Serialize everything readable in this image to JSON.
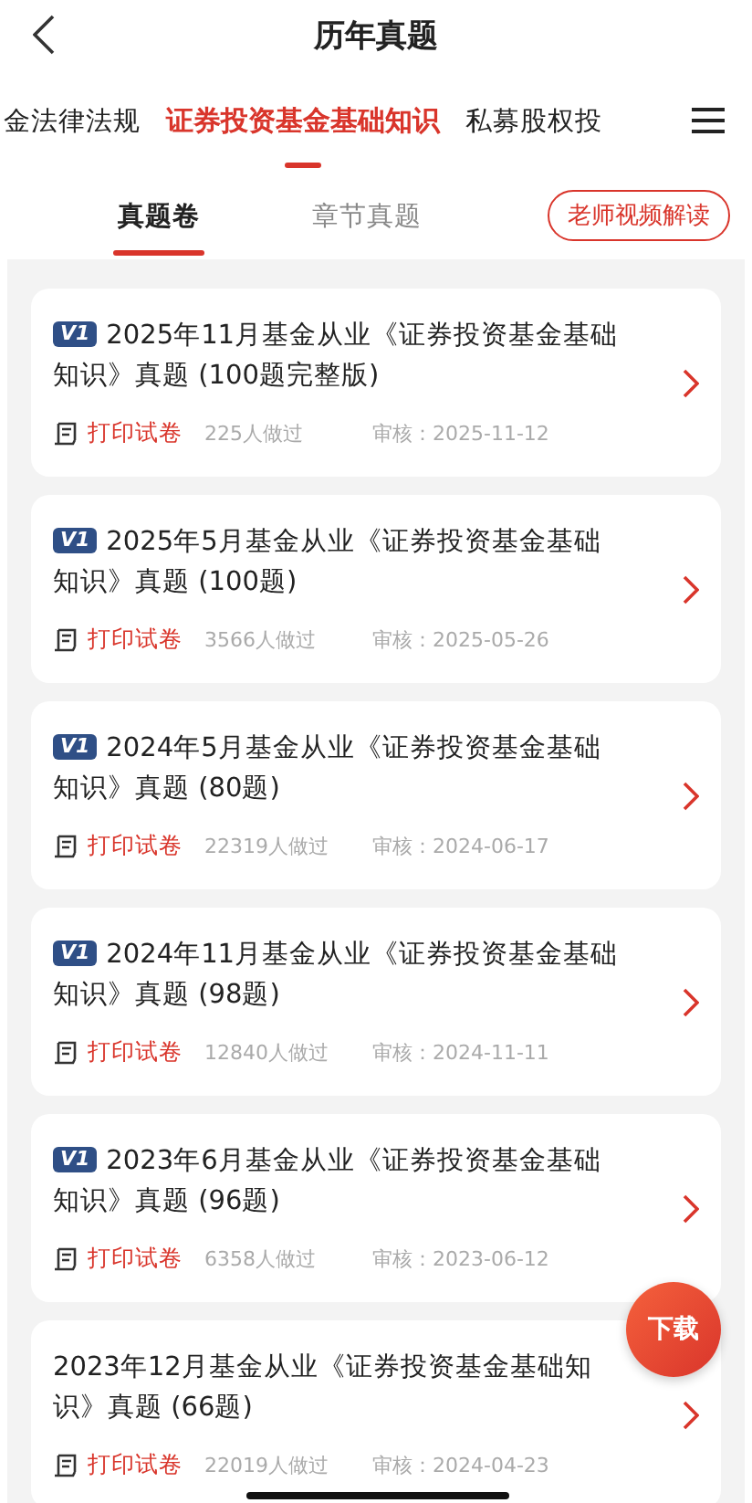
{
  "header": {
    "title": "历年真题"
  },
  "categories": [
    {
      "label": "金法律法规",
      "selected": false
    },
    {
      "label": "证券投资基金基础知识",
      "selected": true
    },
    {
      "label": "私募股权投",
      "selected": false
    }
  ],
  "subtabs": [
    {
      "label": "真题卷",
      "selected": true
    },
    {
      "label": "章节真题",
      "selected": false
    }
  ],
  "video_button": "老师视频解读",
  "papers": [
    {
      "badge": "V1",
      "title": "2025年11月基金从业《证券投资基金基础知识》真题 (100题完整版)",
      "print": "打印试卷",
      "done": "225人做过",
      "review": "审核：2025-11-12"
    },
    {
      "badge": "V1",
      "title": "2025年5月基金从业《证券投资基金基础知识》真题 (100题)",
      "print": "打印试卷",
      "done": "3566人做过",
      "review": "审核：2025-05-26"
    },
    {
      "badge": "V1",
      "title": "2024年5月基金从业《证券投资基金基础知识》真题 (80题)",
      "print": "打印试卷",
      "done": "22319人做过",
      "review": "审核：2024-06-17"
    },
    {
      "badge": "V1",
      "title": "2024年11月基金从业《证券投资基金基础知识》真题 (98题)",
      "print": "打印试卷",
      "done": "12840人做过",
      "review": "审核：2024-11-11"
    },
    {
      "badge": "V1",
      "title": "2023年6月基金从业《证券投资基金基础知识》真题 (96题)",
      "print": "打印试卷",
      "done": "6358人做过",
      "review": "审核：2023-06-12"
    },
    {
      "title": "2023年12月基金从业《证券投资基金基础知识》真题 (66题)",
      "print": "打印试卷",
      "done": "22019人做过",
      "review": "审核：2024-04-23"
    }
  ],
  "download_button": "下载"
}
